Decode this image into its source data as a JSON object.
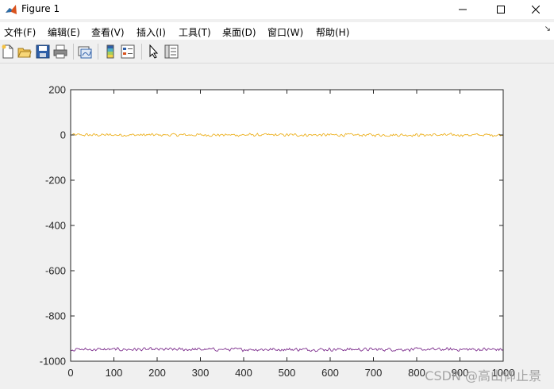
{
  "window": {
    "title": "Figure 1"
  },
  "menu": {
    "items": [
      "文件(F)",
      "编辑(E)",
      "查看(V)",
      "插入(I)",
      "工具(T)",
      "桌面(D)",
      "窗口(W)",
      "帮助(H)"
    ],
    "overflow_arrow": "↘"
  },
  "toolbar": {
    "buttons": [
      {
        "icon": "new-figure-icon"
      },
      {
        "icon": "open-file-icon"
      },
      {
        "icon": "save-icon"
      },
      {
        "icon": "print-icon"
      },
      {
        "icon": "link-plot-icon"
      },
      {
        "icon": "colorbar-icon"
      },
      {
        "icon": "legend-icon"
      },
      {
        "icon": "edit-plot-icon"
      },
      {
        "icon": "property-inspector-icon"
      }
    ]
  },
  "chart_data": {
    "type": "line",
    "title": "",
    "xlabel": "",
    "ylabel": "",
    "xlim": [
      0,
      1000
    ],
    "ylim": [
      -1000,
      200
    ],
    "xticks": [
      0,
      100,
      200,
      300,
      400,
      500,
      600,
      700,
      800,
      900,
      1000
    ],
    "yticks": [
      -1000,
      -800,
      -600,
      -400,
      -200,
      0,
      200
    ],
    "grid": false,
    "legend": "none",
    "series": [
      {
        "color": "#EDB120",
        "mean": 0,
        "noise_amplitude": 8
      },
      {
        "color": "#7E2F8E",
        "mean": -948,
        "noise_amplitude": 9
      }
    ]
  },
  "watermark": "CSDN @高山仰止景"
}
